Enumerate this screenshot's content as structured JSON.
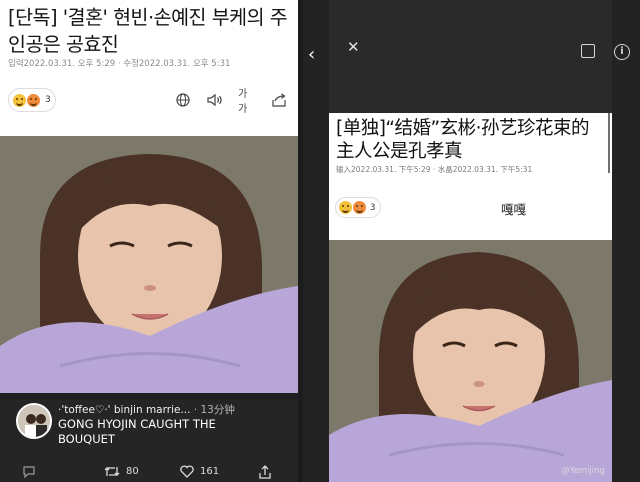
{
  "left": {
    "title": "[단독] '결혼' 현빈·손예진 부케의 주인공은 공효진",
    "meta": "입력2022.03.31. 오후 5:29 · 수정2022.03.31. 오후 5:31",
    "reaction_count": "3",
    "tools": {
      "globe_icon": "globe-icon",
      "speaker_icon": "speaker-icon",
      "font_size_label": "가가",
      "share_icon": "share-icon"
    },
    "comment": {
      "user": "·'toffee♡·' binjin marrie...",
      "time": "· 13分钟",
      "text": "GONG HYOJIN CAUGHT THE BOUQUET"
    },
    "actions": {
      "retweet_count": "80",
      "like_count": "161"
    }
  },
  "right": {
    "title": "[单独]“结婚”玄彬·孙艺珍花束的主人公是孔孝真",
    "meta": "输入2022.03.31. 下午5:29 · 水晶2022.03.31. 下午5:31",
    "reaction_count": "3",
    "translated_name": "嘎嘎",
    "info_label": "i"
  },
  "watermark": "@Yemijing",
  "colors": {
    "dark_bg": "#232323",
    "photo_bg": "#7e7a6c",
    "sweater": "#b8a6d8"
  }
}
